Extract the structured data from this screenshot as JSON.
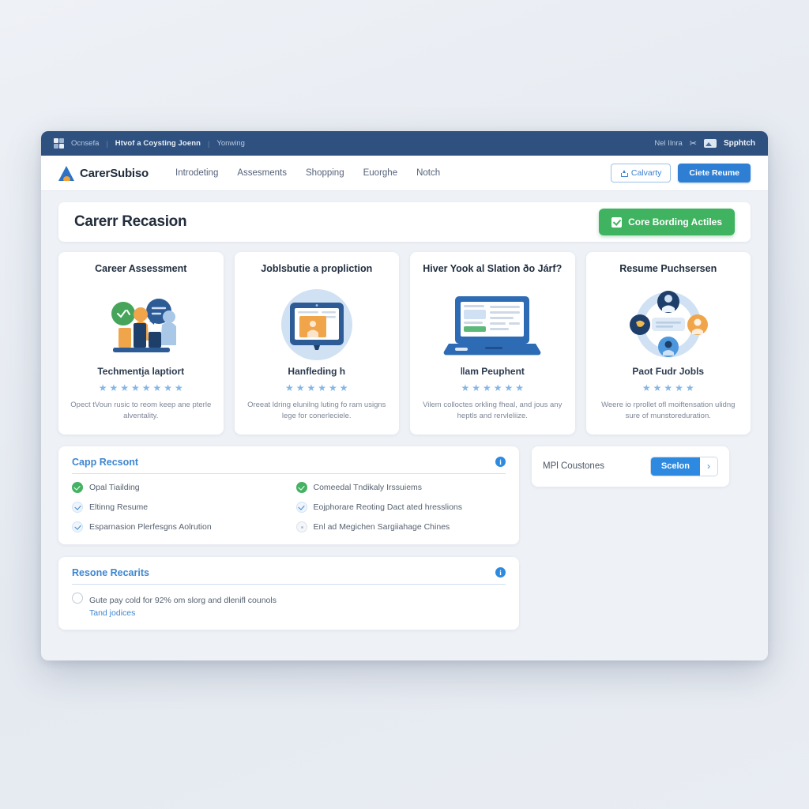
{
  "topbar": {
    "logo_icon": "grid-squares-icon",
    "crumbs": [
      "Ocnsefa",
      "Htvof a Coysting Joenn",
      "Yonwing"
    ],
    "right_label": "Nel Ilnra",
    "pin_icon": "pin-icon",
    "chip_icon": "image-chip-icon",
    "user_label": "Spphtch"
  },
  "navbar": {
    "brand": "CarerSubiso",
    "brand_icon": "mountain-logo-icon",
    "links": [
      "Introdeting",
      "Assesments",
      "Shopping",
      "Euorghe",
      "Notch"
    ],
    "ghost_button": {
      "label": "Calvarty",
      "icon": "upload-icon"
    },
    "primary_button": {
      "label": "Ciete Reume"
    }
  },
  "page": {
    "title": "Carerr Recasion",
    "action_button": {
      "label": "Core Bording Actiles",
      "icon": "checkbox-icon",
      "color": "#40b361"
    }
  },
  "cards": [
    {
      "title": "Career Assessment",
      "illustration": "people-bar-chart-icon",
      "subtitle": "Techmenti̧a laptiort",
      "stars": 8,
      "description": "Opect tVoun rusic to reom keep ane pterle alventality."
    },
    {
      "title": "Joblsbutie a propliction",
      "illustration": "tablet-screen-icon",
      "subtitle": "Hanfleding h",
      "stars": 6,
      "description": "Oreeat ldring elunilng luting fo ram usigns lege for conerleciele."
    },
    {
      "title": "Hiver Yook al Slation ðo Járf?",
      "illustration": "laptop-dashboard-icon",
      "subtitle": "ǁam Peuphent",
      "stars": 6,
      "description": "Vilem colloctes orkling fheal, and jous any heptls and rervleliize."
    },
    {
      "title": "Resume Puchsersen",
      "illustration": "network-avatars-icon",
      "subtitle": "Paot Fudr Jobls",
      "stars": 5,
      "description": "Weere io rprollet ofl moiftensation ulidng sure of munstoreduration."
    }
  ],
  "checklist_panel": {
    "title": "Capp Recsont",
    "info_icon": "info-icon",
    "items": [
      {
        "label": "Opal Tiailding",
        "state": "green"
      },
      {
        "label": "Comeedal Tndikaly Irssuiems",
        "state": "green"
      },
      {
        "label": "Eltinng Resume",
        "state": "blue"
      },
      {
        "label": "Eojphorare Reoting Dact ated hresslions",
        "state": "blue"
      },
      {
        "label": "Esparnasion Plerfesgns Aolrution",
        "state": "blue"
      },
      {
        "label": "Enl ad Megichen Sargiiahage Chines",
        "state": "empty"
      }
    ]
  },
  "side_panel": {
    "label": "MPl Coustones",
    "segment_label": "Scelon",
    "chevron_icon": "chevron-right-icon"
  },
  "results_panel": {
    "title": "Resone Recarits",
    "info_icon": "info-icon",
    "radio_icon": "radio-unchecked-icon",
    "text": "Gute pay cold for 92% om slorg and dlenifl counols",
    "link": "Tand jodices"
  }
}
